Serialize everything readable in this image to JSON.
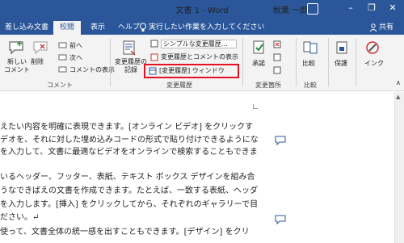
{
  "titlebar": {
    "doc_title": "文書 1 - Word",
    "user": "秋葉 一郎",
    "account_initials": "秋葉",
    "min": "–",
    "restore": "❐",
    "close": "✕"
  },
  "tabs": [
    "差し込み文書",
    "校閲",
    "表示",
    "ヘルプ"
  ],
  "tell_me": "実行したい作業を入力してください",
  "share": "共有",
  "ribbon": {
    "new_comment": "新しい\nコメント",
    "delete": "削除",
    "prev": "前へ",
    "next": "次へ",
    "show_comments": "コメントの表示",
    "group_comments": "コメント",
    "track_changes": "変更履歴の\n記録",
    "markup_simple": "シンプルな変更履歴…",
    "show_markup": "変更履歴とコメントの表示",
    "reviewing_pane": "[変更履歴] ウィンドウ",
    "group_tracking": "変更履歴",
    "accept": "承諾",
    "group_changes": "変更箇所",
    "compare": "比較",
    "group_compare": "比較",
    "protect": "保護",
    "ink": "インク"
  },
  "doc_lines": [
    "えたい内容を明確に表現できます。[オンライン ビデオ] をクリックす",
    "デオを、それに対した埋め込みコードの形式で貼り付けできるようにな",
    "を入力して、文書に最適なビデオをオンラインで検索することもできま",
    "",
    "いるヘッダー、フッター、表紙、テキスト ボックス デザインを組み合",
    "うなできばえの文書を作成できます。たとえば、一致する表紙、ヘッダ",
    "を入力します。[挿入] をクリックしてから、それぞれのギャラリーで目",
    "ださい。↵",
    "使って、文書全体の統一感を出すこともできます。[デザイン] をクリ"
  ],
  "colors": {
    "accent": "#2b579a",
    "highlight": "#e81123",
    "ribbon_bg": "#f3f3f3"
  }
}
